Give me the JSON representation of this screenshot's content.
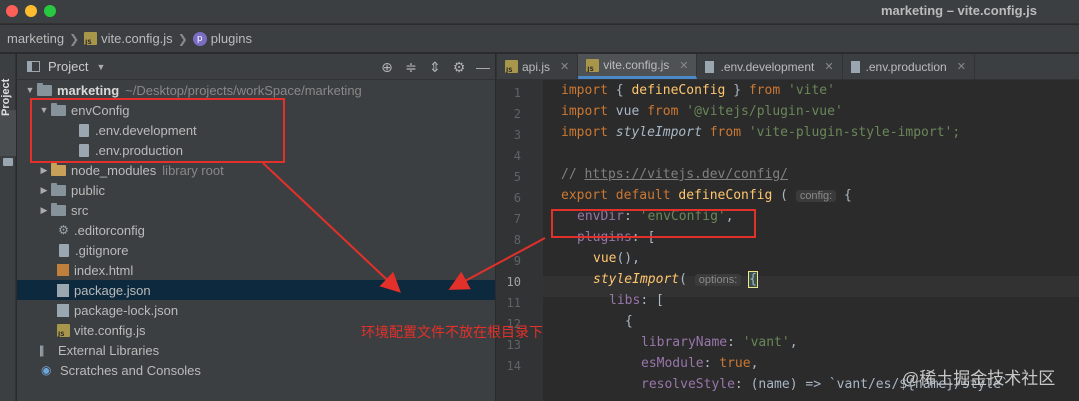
{
  "window": {
    "title": "marketing – vite.config.js"
  },
  "navbar": {
    "items": [
      "marketing",
      "vite.config.js",
      "plugins"
    ]
  },
  "sidestrip": {
    "label": "Project"
  },
  "project_panel": {
    "title": "Project",
    "tree": [
      {
        "label": "marketing",
        "hint": "~/Desktop/projects/workSpace/marketing"
      },
      {
        "label": "envConfig"
      },
      {
        "label": ".env.development"
      },
      {
        "label": ".env.production"
      },
      {
        "label": "node_modules",
        "hint": "library root"
      },
      {
        "label": "public"
      },
      {
        "label": "src"
      },
      {
        "label": ".editorconfig"
      },
      {
        "label": ".gitignore"
      },
      {
        "label": "index.html"
      },
      {
        "label": "package.json"
      },
      {
        "label": "package-lock.json"
      },
      {
        "label": "vite.config.js"
      },
      {
        "label": "External Libraries"
      },
      {
        "label": "Scratches and Consoles"
      }
    ]
  },
  "tabs": [
    "api.js",
    "vite.config.js",
    ".env.development",
    ".env.production"
  ],
  "editor": {
    "line_numbers": [
      "1",
      "2",
      "3",
      "4",
      "5",
      "6",
      "7",
      "8",
      "9",
      "10",
      "11",
      "12",
      "13",
      "14"
    ],
    "current_line": "10",
    "code": {
      "l1_kw": "import",
      "l1_mid": " { ",
      "l1_fn": "defineConfig",
      "l1_end": " } ",
      "l1_from": "from",
      "l1_str": " 'vite'",
      "l2_kw": "import",
      "l2_name": " vue ",
      "l2_from": "from",
      "l2_str": " '@vitejs/plugin-vue'",
      "l3_kw": "import",
      "l3_name": "styleImport",
      "l3_from": "from",
      "l3_str": " 'vite-plugin-style-import';",
      "l5_cmt": "// ",
      "l5_link": "https://vitejs.dev/config/",
      "l6_kw": "export default",
      "l6_fn": "defineConfig",
      "l6_open": " (",
      "l6_hint": "config:",
      "l6_brace": " {",
      "l7_prop": "envDir",
      "l7_colon": ": ",
      "l7_str": "'envConfig'",
      "l7_comma": ",",
      "l8_prop": "plugins",
      "l8_rest": ": [",
      "l9_fn": "vue",
      "l9_rest": "(),",
      "l10_fn": "styleImport",
      "l10_open": "(",
      "l10_hint": "options:",
      "l10_brace": "{",
      "l11_prop": "libs",
      "l11_rest": ": [",
      "l12": "{",
      "l13_prop": "libraryName",
      "l13_colon": ": ",
      "l13_str": "'vant'",
      "l13_comma": ",",
      "l14_prop": "esModule",
      "l14_colon": ": ",
      "l14_kw": "true",
      "l14_comma": ",",
      "l15_prop": "resolveStyle",
      "l15_rest": ": (name) => `vant/es/${name}/style`"
    }
  },
  "annotation": {
    "text": "环境配置文件不放在根目录下"
  },
  "watermark": {
    "text": "@稀土掘金技术社区"
  },
  "colors": {
    "annotation_red": "#e3302a",
    "selection": "#0d293e",
    "keyword": "#cc7832",
    "string": "#6a8759"
  }
}
